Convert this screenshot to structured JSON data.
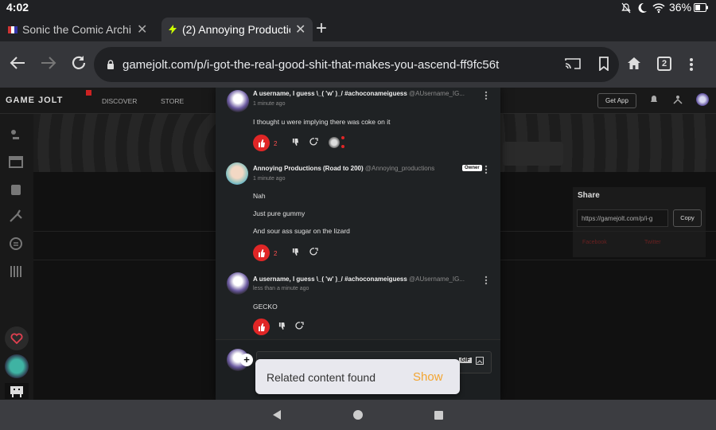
{
  "status_bar": {
    "time": "4:02",
    "battery": "36%",
    "icons": [
      "mute-icon",
      "moon-icon",
      "wifi-icon",
      "battery-icon"
    ]
  },
  "tabs": [
    {
      "title": "Sonic the Comic Archi",
      "active": false
    },
    {
      "title": "(2) Annoying Productio",
      "active": true
    }
  ],
  "url_bar": {
    "url": "gamejolt.com/p/i-got-the-real-good-shit-that-makes-you-ascend-ff9fc56t",
    "tab_count": "2"
  },
  "site_nav": {
    "logo": "GAME JOLT",
    "discover": "DISCOVER",
    "store": "STORE",
    "get_app": "Get App"
  },
  "share": {
    "title": "Share",
    "link": "https://gamejolt.com/p/i-g",
    "copy_label": "Copy",
    "facebook": "Facebook",
    "twitter": "Twitter"
  },
  "comments": [
    {
      "username": "A username, I guess \\_( 'w' )_/ #achoconameiguess",
      "handle": "@AUsername_IG...",
      "time": "1 minute ago",
      "lines": [
        "I thought u were implying there was coke on it"
      ],
      "likes": "2"
    },
    {
      "username": "Annoying Productions (Road to 200)",
      "handle": "@Annoying_productions",
      "badge": "Owner",
      "time": "1 minute ago",
      "lines": [
        "Nah",
        "Just pure gummy",
        "And sour ass sugar on the lizard"
      ],
      "likes": "2"
    },
    {
      "username": "A username, I guess \\_( 'w' )_/ #achoconameiguess",
      "handle": "@AUsername_IG...",
      "time": "less than a minute ago",
      "lines": [
        "GECKO"
      ],
      "likes": ""
    }
  ],
  "composer": {
    "gif_label": "GIF"
  },
  "toast": {
    "message": "Related content found",
    "action": "Show"
  },
  "colors": {
    "accent": "#e02626",
    "toast_action": "#f3a531",
    "modal_bg": "#1f2224"
  }
}
